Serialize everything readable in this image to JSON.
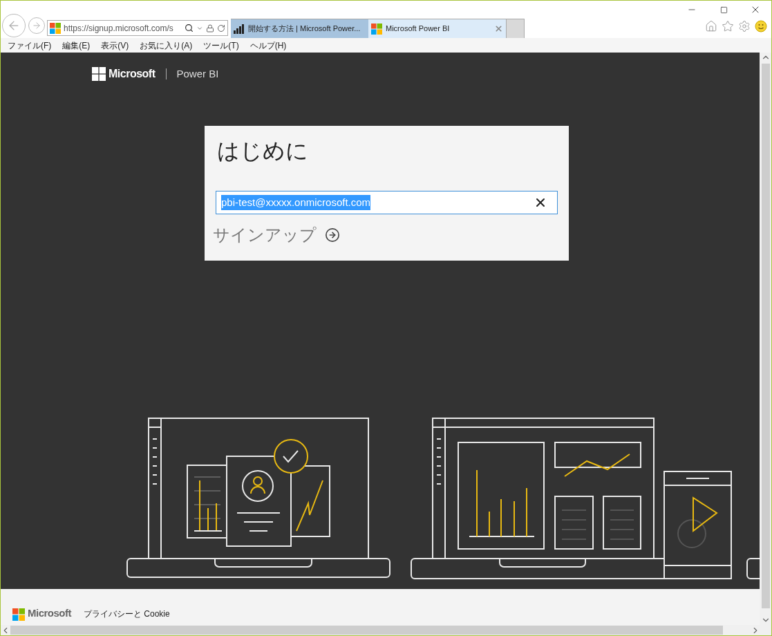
{
  "browser": {
    "address": "https://signup.microsoft.com/s",
    "tabs": [
      {
        "title": "開始する方法 | Microsoft Power...",
        "kind": "chart",
        "selected": false
      },
      {
        "title": "Microsoft Power BI",
        "kind": "windows",
        "selected": true
      }
    ]
  },
  "menu": [
    "ファイル(F)",
    "編集(E)",
    "表示(V)",
    "お気に入り(A)",
    "ツール(T)",
    "ヘルプ(H)"
  ],
  "header": {
    "brand": "Microsoft",
    "product": "Power BI"
  },
  "signup": {
    "title": "はじめに",
    "email": "pbi-test@xxxxx.onmicrosoft.com",
    "email_selected": true,
    "submit": "サインアップ"
  },
  "footer": {
    "brand": "Microsoft",
    "privacy": "プライバシーと Cookie"
  }
}
